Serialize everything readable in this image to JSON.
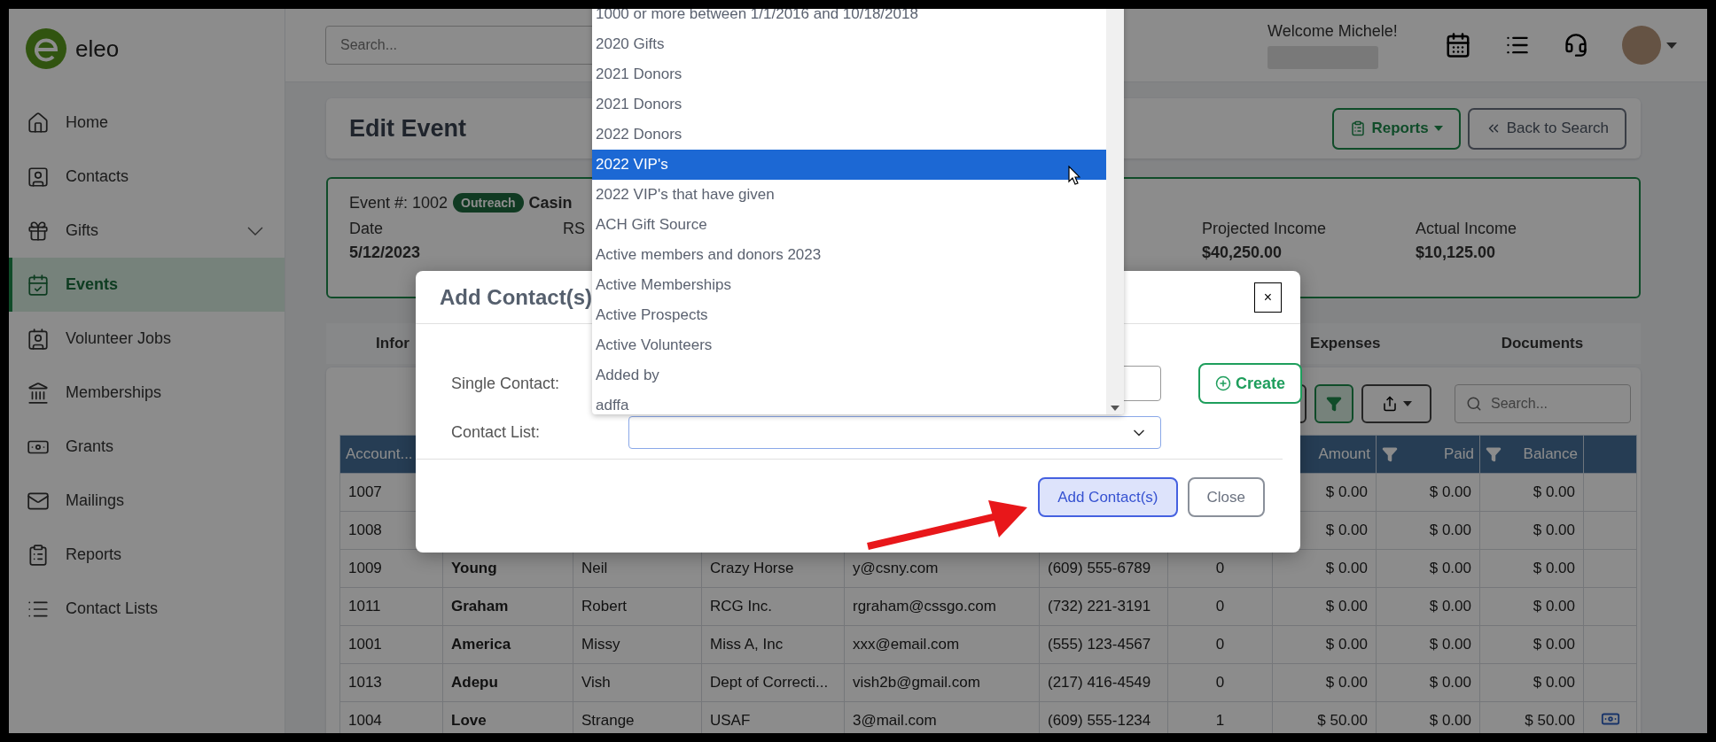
{
  "sidebar": {
    "logo": "eleo",
    "items": [
      {
        "label": "Home",
        "selected": false,
        "has_submenu": false
      },
      {
        "label": "Contacts",
        "selected": false,
        "has_submenu": false
      },
      {
        "label": "Gifts",
        "selected": false,
        "has_submenu": true
      },
      {
        "label": "Events",
        "selected": true,
        "has_submenu": false
      },
      {
        "label": "Volunteer Jobs",
        "selected": false,
        "has_submenu": false
      },
      {
        "label": "Memberships",
        "selected": false,
        "has_submenu": false
      },
      {
        "label": "Grants",
        "selected": false,
        "has_submenu": false
      },
      {
        "label": "Mailings",
        "selected": false,
        "has_submenu": false
      },
      {
        "label": "Reports",
        "selected": false,
        "has_submenu": false
      },
      {
        "label": "Contact Lists",
        "selected": false,
        "has_submenu": false
      }
    ]
  },
  "topbar": {
    "search": {
      "placeholder": "Search..."
    },
    "welcome": "Welcome Michele!"
  },
  "page": {
    "title": "Edit Event",
    "reports_button": "Reports",
    "back_button": "Back to Search"
  },
  "event": {
    "number": "Event #: 1002",
    "tag": "Outreach",
    "name": "Casin",
    "fields": [
      {
        "label": "Date",
        "value": "5/12/2023"
      },
      {
        "label": "RS"
      },
      {
        "label": "Projected Income",
        "value": "$40,250.00"
      },
      {
        "label": "Actual Income",
        "value": "$10,125.00"
      }
    ]
  },
  "tabs": [
    {
      "label": "Infor"
    },
    {
      "label": "Expenses"
    },
    {
      "label": "Documents"
    }
  ],
  "table": {
    "search": {
      "placeholder": "Search..."
    },
    "columns": [
      {
        "label": "Account..."
      },
      {},
      {},
      {},
      {},
      {},
      {},
      {
        "label": "Amount"
      },
      {
        "label": "Paid",
        "filter": true
      },
      {
        "label": "Balance",
        "filter": true
      },
      {}
    ],
    "rows": [
      {
        "cells": [
          "1007",
          null,
          null,
          null,
          null,
          null,
          null,
          "$ 0.00",
          "$ 0.00",
          "$ 0.00"
        ]
      },
      {
        "cells": [
          "1008",
          null,
          null,
          null,
          null,
          null,
          null,
          "$ 0.00",
          "$ 0.00",
          "$ 0.00"
        ]
      },
      {
        "cells": [
          "1009",
          "Young",
          "Neil",
          "Crazy Horse",
          "y@csny.com",
          "(609) 555-6789",
          "0",
          "$ 0.00",
          "$ 0.00",
          "$ 0.00"
        ]
      },
      {
        "cells": [
          "1011",
          "Graham",
          "Robert",
          "RCG Inc.",
          "rgraham@cssgo.com",
          "(732) 221-3191",
          "0",
          "$ 0.00",
          "$ 0.00",
          "$ 0.00"
        ]
      },
      {
        "cells": [
          "1001",
          "America",
          "Missy",
          "Miss A, Inc",
          "xxx@email.com",
          "(555) 123-4567",
          "0",
          "$ 0.00",
          "$ 0.00",
          "$ 0.00"
        ]
      },
      {
        "cells": [
          "1013",
          "Adepu",
          "Vish",
          "Dept of Correcti...",
          "vish2b@gmail.com",
          "(217) 416-4549",
          "0",
          "$ 0.00",
          "$ 0.00",
          "$ 0.00"
        ]
      },
      {
        "cells": [
          "1004",
          "Love",
          "Strange",
          "USAF",
          "3@mail.com",
          "(609) 555-1234",
          "1",
          "$ 50.00",
          "$ 0.00",
          "$ 50.00"
        ],
        "payment_icon": true
      }
    ]
  },
  "modal": {
    "title": "Add Contact(s)",
    "close_glyph": "×",
    "single_label": "Single Contact:",
    "list_label": "Contact List:",
    "create_button": "Create",
    "buttons": [
      {
        "label": "Add Contact(s)",
        "kind": "primary"
      },
      {
        "label": "Close",
        "kind": "secondary"
      }
    ]
  },
  "dropdown": {
    "items": [
      {
        "label": "1000 or more between 1/1/2016 and 10/18/2018",
        "selected": false
      },
      {
        "label": "2020 Gifts",
        "selected": false
      },
      {
        "label": "2021 Donors",
        "selected": false
      },
      {
        "label": "2021 Donors",
        "selected": false
      },
      {
        "label": "2022 Donors",
        "selected": false
      },
      {
        "label": "2022 VIP's",
        "selected": true
      },
      {
        "label": "2022 VIP's that have given",
        "selected": false
      },
      {
        "label": "ACH Gift Source",
        "selected": false
      },
      {
        "label": "Active members and donors 2023",
        "selected": false
      },
      {
        "label": "Active Memberships",
        "selected": false
      },
      {
        "label": "Active Prospects",
        "selected": false
      },
      {
        "label": "Active Volunteers",
        "selected": false
      },
      {
        "label": "Added by",
        "selected": false
      },
      {
        "label": "adffa",
        "selected": false
      }
    ]
  }
}
